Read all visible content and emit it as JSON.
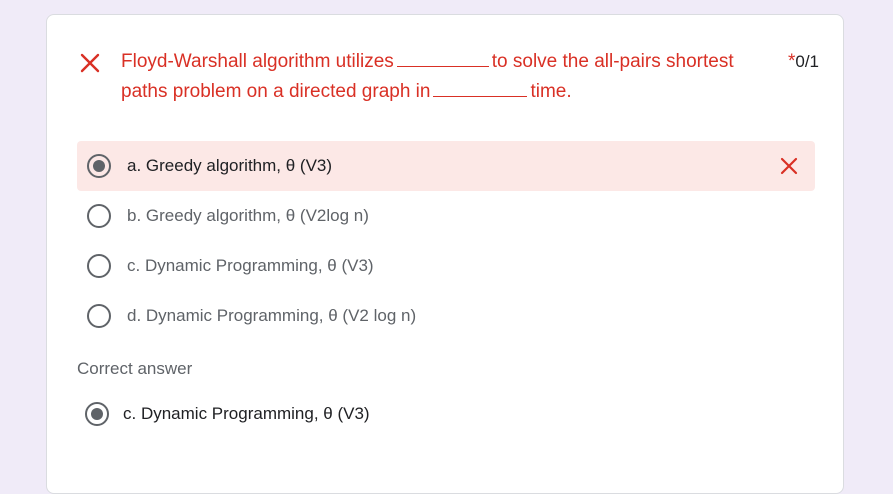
{
  "question": {
    "text_part1": "Floyd-Warshall algorithm utilizes",
    "text_part2": "to solve the all-pairs shortest paths problem on a directed graph in",
    "text_part3": "time.",
    "required_marker": "*",
    "score": "0/1",
    "status_icon": "close-icon",
    "status_color": "#d93025"
  },
  "options": [
    {
      "label": "a. Greedy algorithm, θ (V3)",
      "selected": true,
      "incorrect": true
    },
    {
      "label": "b. Greedy algorithm, θ (V2log n)",
      "selected": false
    },
    {
      "label": "c. Dynamic Programming, θ (V3)",
      "selected": false
    },
    {
      "label": "d. Dynamic Programming, θ (V2 log n)",
      "selected": false
    }
  ],
  "correct_answer": {
    "title": "Correct answer",
    "label": "c. Dynamic Programming, θ (V3)"
  },
  "colors": {
    "error": "#d93025",
    "wrong_bg": "#fce8e6",
    "page_bg": "#f0ebf8"
  }
}
